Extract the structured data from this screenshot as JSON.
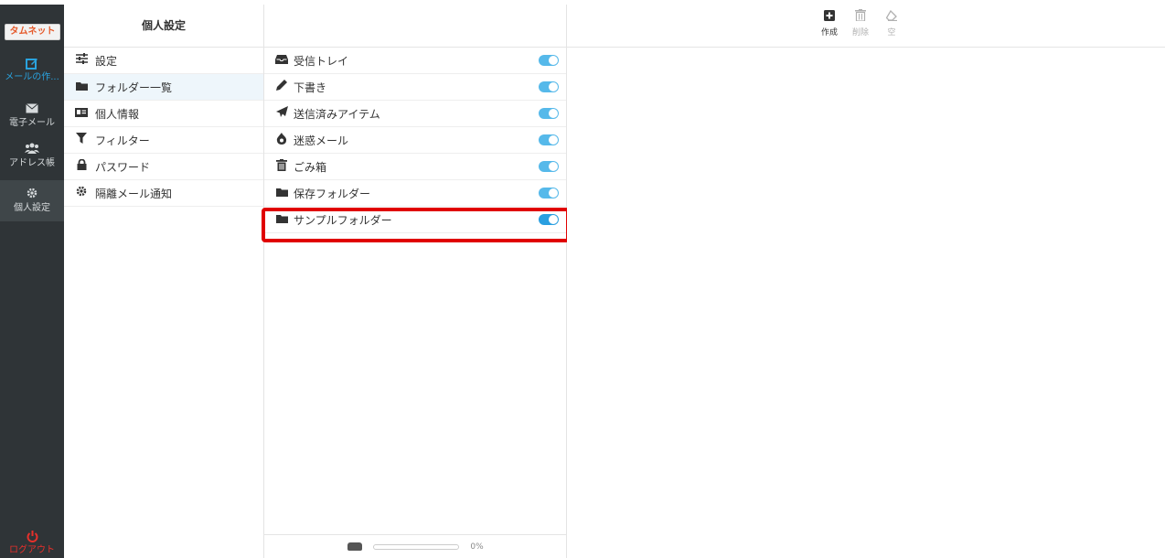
{
  "brand": "タムネット",
  "rail": {
    "compose": {
      "label": "メールの作...",
      "icon": "compose-icon"
    },
    "mail": {
      "label": "電子メール",
      "icon": "envelope-icon"
    },
    "contacts": {
      "label": "アドレス帳",
      "icon": "users-icon"
    },
    "settings": {
      "label": "個人設定",
      "icon": "gear-icon"
    },
    "logout": {
      "label": "ログアウト",
      "icon": "power-icon"
    }
  },
  "settings_header": "個人設定",
  "settings_menu": [
    {
      "label": "設定",
      "icon": "sliders-icon"
    },
    {
      "label": "フォルダー一覧",
      "icon": "folder-icon"
    },
    {
      "label": "個人情報",
      "icon": "id-card-icon"
    },
    {
      "label": "フィルター",
      "icon": "filter-icon"
    },
    {
      "label": "パスワード",
      "icon": "lock-icon"
    },
    {
      "label": "隔離メール通知",
      "icon": "gear-icon"
    }
  ],
  "folders": [
    {
      "label": "受信トレイ",
      "icon": "inbox-icon",
      "subscribed": true
    },
    {
      "label": "下書き",
      "icon": "pencil-icon",
      "subscribed": true
    },
    {
      "label": "送信済みアイテム",
      "icon": "paper-plane-icon",
      "subscribed": true
    },
    {
      "label": "迷惑メール",
      "icon": "fire-icon",
      "subscribed": true
    },
    {
      "label": "ごみ箱",
      "icon": "trash-icon",
      "subscribed": true
    },
    {
      "label": "保存フォルダー",
      "icon": "folder-icon",
      "subscribed": true
    },
    {
      "label": "サンプルフォルダー",
      "icon": "folder-icon",
      "subscribed": true
    }
  ],
  "quota": {
    "percent_label": "0%",
    "used_fraction": 0
  },
  "toolbar": {
    "create_label": "作成",
    "delete_label": "削除",
    "empty_label": "空"
  },
  "colors": {
    "rail_bg": "#2f3437",
    "accent": "#2aa3df",
    "toggle": "#56b9ea",
    "highlight": "#e00000",
    "logout": "#e6302b"
  }
}
